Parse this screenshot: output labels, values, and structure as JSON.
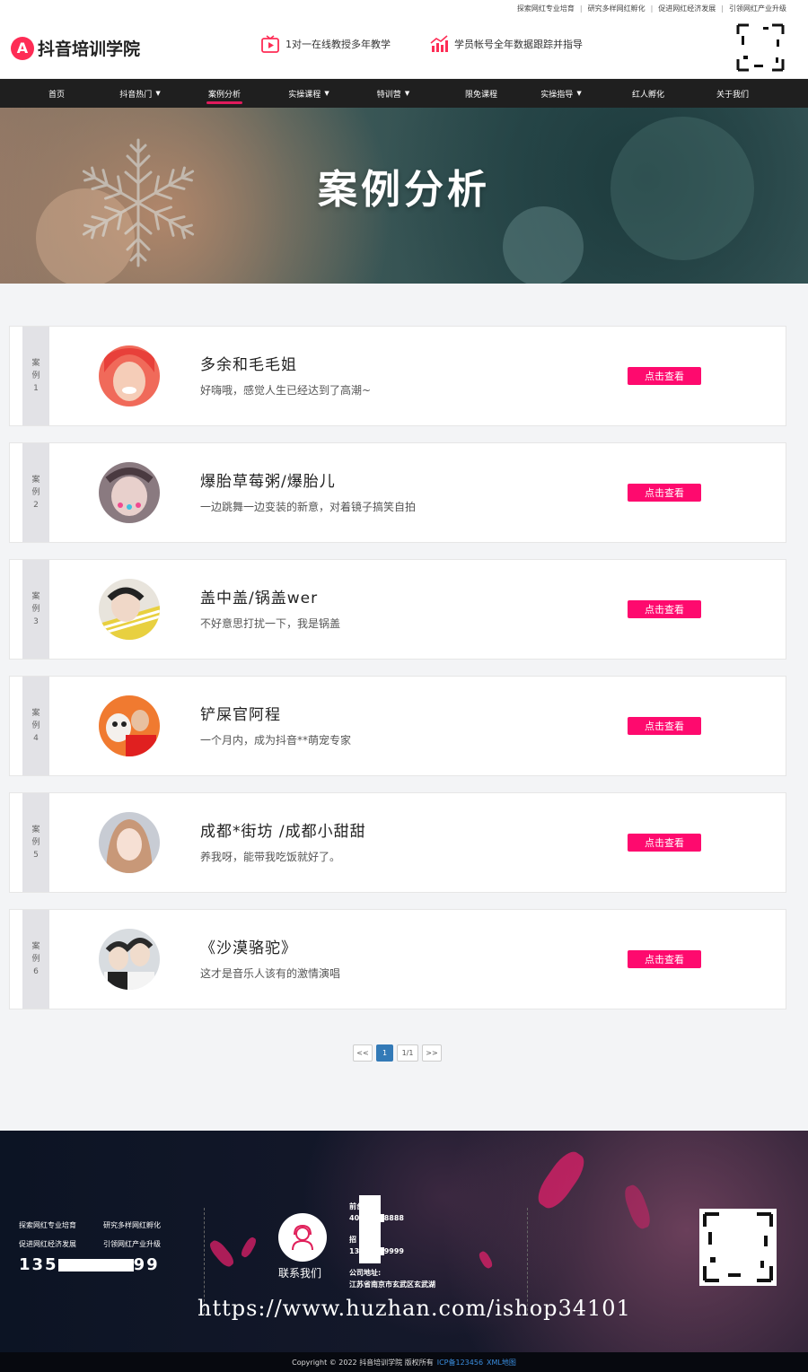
{
  "topbar": {
    "links": [
      "探索网红专业培育",
      "研究多样网红孵化",
      "促进网红经济发展",
      "引领网红产业升级"
    ],
    "separator": "|"
  },
  "header": {
    "logo_mark": "A",
    "logo_text": "抖音培训学院",
    "feature1": "1对一在线教授多年教学",
    "feature2": "学员帐号全年数据跟踪并指导",
    "brand_color": "#fe2c55"
  },
  "nav": {
    "items": [
      {
        "label": "首页",
        "dropdown": false
      },
      {
        "label": "抖音热门",
        "dropdown": true
      },
      {
        "label": "案例分析",
        "dropdown": false,
        "active": true
      },
      {
        "label": "实操课程",
        "dropdown": true
      },
      {
        "label": "特训营",
        "dropdown": true
      },
      {
        "label": "限免课程",
        "dropdown": false
      },
      {
        "label": "实操指导",
        "dropdown": true
      },
      {
        "label": "红人孵化",
        "dropdown": false
      },
      {
        "label": "关于我们",
        "dropdown": false
      }
    ],
    "caret": "▼"
  },
  "banner": {
    "title": "案例分析"
  },
  "cases": [
    {
      "tag": [
        "案",
        "例",
        "1"
      ],
      "title": "多余和毛毛姐",
      "desc": "好嗨哦，感觉人生已经达到了高潮~",
      "button": "点击查看"
    },
    {
      "tag": [
        "案",
        "例",
        "2"
      ],
      "title": "爆胎草莓粥/爆胎儿",
      "desc": "一边跳舞一边变装的新意，对着镜子搞笑自拍",
      "button": "点击查看"
    },
    {
      "tag": [
        "案",
        "例",
        "3"
      ],
      "title": "盖中盖/锅盖wer",
      "desc": "不好意思打扰一下，我是锅盖",
      "button": "点击查看"
    },
    {
      "tag": [
        "案",
        "例",
        "4"
      ],
      "title": "铲屎官阿程",
      "desc": "一个月内，成为抖音**萌宠专家",
      "button": "点击查看"
    },
    {
      "tag": [
        "案",
        "例",
        "5"
      ],
      "title": "成都*街坊 /成都小甜甜",
      "desc": "养我呀，能带我吃饭就好了。",
      "button": "点击查看"
    },
    {
      "tag": [
        "案",
        "例",
        "6"
      ],
      "title": "《沙漠骆驼》",
      "desc": "这才是音乐人该有的激情演唱",
      "button": "点击查看"
    }
  ],
  "pagination": {
    "prev": "<<",
    "current": "1",
    "total": "1/1",
    "next": ">>"
  },
  "footer": {
    "links": [
      "探索网红专业培育",
      "研究多样网红孵化",
      "促进网红经济发展",
      "引领网红产业升级"
    ],
    "phone": "135",
    "phone_tail": "99",
    "contact_label": "联系我们",
    "front_desk_label": "前台座机:",
    "front_desk_value": "400",
    "front_desk_tail": "8888",
    "recruit_label": "招",
    "recruit_value": "135",
    "recruit_tail": "9999",
    "address_label": "公司地址:",
    "address_value": "江苏省南京市玄武区玄武湖",
    "watermark": "https://www.huzhan.com/ishop34101"
  },
  "copyright": {
    "text": "Copyright © 2022 抖音培训学院 版权所有",
    "icp": "ICP备123456",
    "xml": "XML地图"
  }
}
